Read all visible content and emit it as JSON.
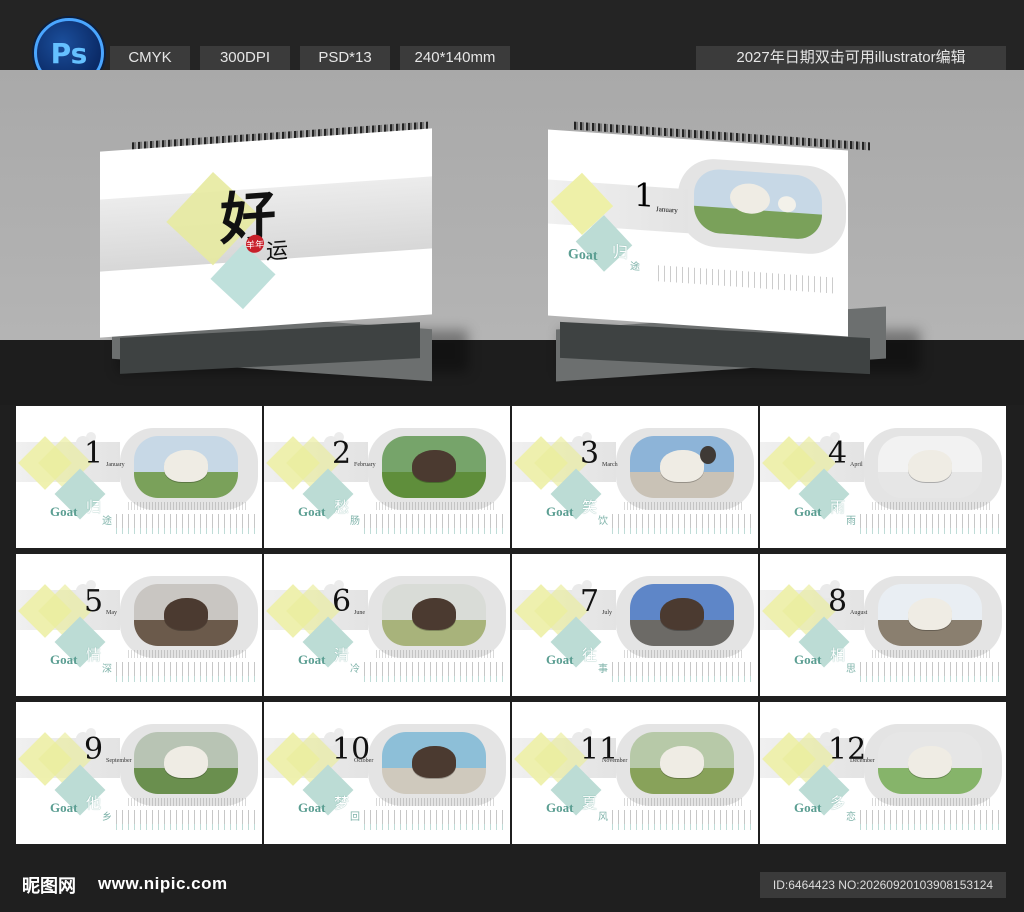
{
  "header": {
    "logo_text": "Ps",
    "tags": [
      "CMYK",
      "300DPI",
      "PSD*13",
      "240*140mm"
    ],
    "note": "2027年日期双击可用illustrator编辑"
  },
  "cover": {
    "title_brush": "好",
    "title_yun": "运",
    "seal": "羊年"
  },
  "months": [
    {
      "num": "1",
      "label": "January",
      "cn1": "归",
      "cn2": "途",
      "sky": "#c7d8e6",
      "ground": "#7aa15a",
      "goat": "light"
    },
    {
      "num": "2",
      "label": "February",
      "cn1": "愁",
      "cn2": "肠",
      "sky": "#76a46a",
      "ground": "#5f8e3b",
      "goat": "dark"
    },
    {
      "num": "3",
      "label": "March",
      "cn1": "笑",
      "cn2": "饮",
      "sky": "#8db4d8",
      "ground": "#c9c2b6",
      "goat": "light"
    },
    {
      "num": "4",
      "label": "April",
      "cn1": "雨",
      "cn2": "雨",
      "sky": "#f2f2f2",
      "ground": "#e6e6e6",
      "goat": "light"
    },
    {
      "num": "5",
      "label": "May",
      "cn1": "情",
      "cn2": "深",
      "sky": "#c9c6c2",
      "ground": "#6b5a4b",
      "goat": "dark"
    },
    {
      "num": "6",
      "label": "June",
      "cn1": "清",
      "cn2": "冷",
      "sky": "#d9dcd7",
      "ground": "#a8b37b",
      "goat": "dark"
    },
    {
      "num": "7",
      "label": "July",
      "cn1": "往",
      "cn2": "事",
      "sky": "#5e86c8",
      "ground": "#6c6a66",
      "goat": "dark"
    },
    {
      "num": "8",
      "label": "August",
      "cn1": "相",
      "cn2": "思",
      "sky": "#e9eef3",
      "ground": "#8a7f6f",
      "goat": "light"
    },
    {
      "num": "9",
      "label": "September",
      "cn1": "他",
      "cn2": "乡",
      "sky": "#b8c4b4",
      "ground": "#6a8f4e",
      "goat": "light"
    },
    {
      "num": "10",
      "label": "October",
      "cn1": "梦",
      "cn2": "回",
      "sky": "#8dbfd8",
      "ground": "#cfc9bd",
      "goat": "dark"
    },
    {
      "num": "11",
      "label": "November",
      "cn1": "夏",
      "cn2": "风",
      "sky": "#b7c9a8",
      "ground": "#88a25a",
      "goat": "light"
    },
    {
      "num": "12",
      "label": "December",
      "cn1": "多",
      "cn2": "恋",
      "sky": "#e6e6e6",
      "ground": "#86b46a",
      "goat": "light"
    }
  ],
  "footer": {
    "brand": "昵图网",
    "site": "www.nipic.com",
    "id_text": "ID:6464423 NO:20260920103908153124"
  },
  "colors": {
    "accent_yellow": "#eef0a8",
    "accent_teal": "#bcdcd5",
    "label_teal": "#5b9e92"
  }
}
